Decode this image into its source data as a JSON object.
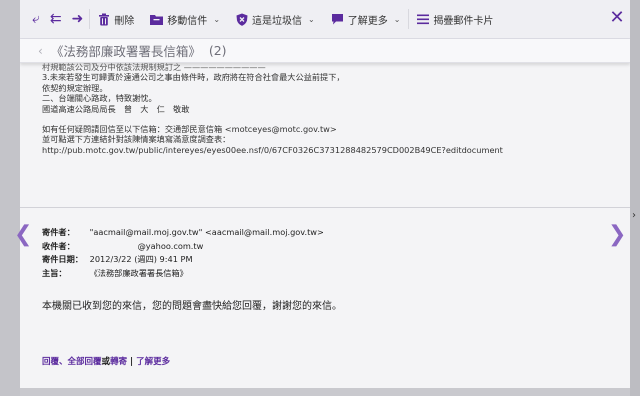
{
  "toolbar": {
    "delete_label": "刪除",
    "move_label": "移動信件",
    "spam_label": "這是垃圾信",
    "more_label": "了解更多",
    "stack_label": "揭疊郵件卡片"
  },
  "subject": {
    "title": "《法務部廉政署署長信箱》",
    "count": "(2)"
  },
  "quoted_lines": {
    "l1": "村規範該公司及分中依該法規制規訂之 ——————————",
    "l2": "3.未來若發生可歸責於遠通公司之事由條件時，政府將在符合社會最大公益前提下，",
    "l3": "依契約規定辦理。",
    "l4": "二、台端關心路政，特致謝忱。",
    "l5": "國道高速公路局局長　曾　大　仁　敬敢",
    "l6": "如有任何疑問請回信至以下信箱：交通部民意信箱 <motceyes@motc.gov.tw>",
    "l7": "並可點選下方連結針對該陳情案填寫滿意度調查表：",
    "l8": "http://pub.motc.gov.tw/public/intereyes/eyes00ee.nsf/0/67CF0326C3731288482579CD002B49CE?editdocument"
  },
  "message": {
    "from_label": "寄件者：",
    "from_value": "\"aacmail@mail.moj.gov.tw\" <aacmail@mail.moj.gov.tw>",
    "to_label": "收件者：",
    "to_value": "@yahoo.com.tw",
    "date_label": "寄件日期：",
    "date_value": "2012/3/22 (週四) 9:41 PM",
    "subject_label": "主旨：",
    "subject_value": "《法務部廉政署署長信箱》",
    "body": "本機關已收到您的來信，您的問題會盡快給您回覆，謝謝您的來信。"
  },
  "footer": {
    "reply": "回覆",
    "sep1": "、",
    "reply_all": "全部回覆",
    "or_text": "或",
    "forward": "轉寄",
    "sep2": " | ",
    "learn_more": "了解更多"
  },
  "colors": {
    "accent": "#5b2b9e",
    "nav_arrow": "#8b67c2",
    "panel_bg": "#f4f4f6",
    "page_bg": "#c9c9ce"
  }
}
